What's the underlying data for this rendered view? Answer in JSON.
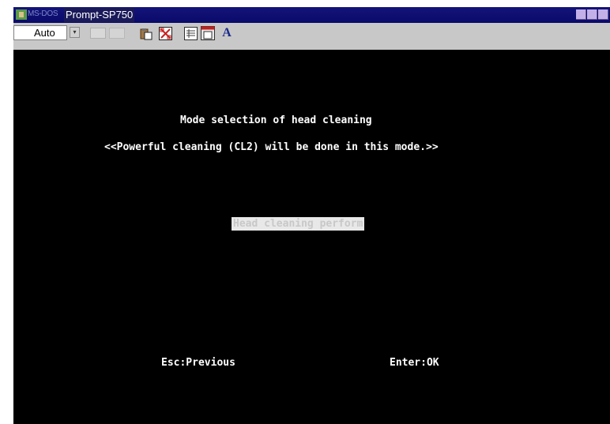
{
  "window": {
    "title_prefix": "MS-DOS",
    "title": "Prompt-SP750"
  },
  "toolbar": {
    "font_size_value": "Auto",
    "icons": [
      "mark-icon",
      "copy-icon",
      "paste-icon",
      "fullscreen-icon",
      "properties-icon",
      "background-icon",
      "font-icon"
    ],
    "font_icon_glyph": "A"
  },
  "screen": {
    "heading": "Mode selection of head cleaning",
    "subheading": "<<Powerful cleaning (CL2) will be done in this mode.>>",
    "selected_option": "Head cleaning perform",
    "footer_left": "Esc:Previous",
    "footer_right": "Enter:OK"
  },
  "colors": {
    "titlebar": "#0a0a6a",
    "screen_background": "#000000",
    "screen_text": "#ffffff",
    "highlight": "#e8e8e8"
  }
}
